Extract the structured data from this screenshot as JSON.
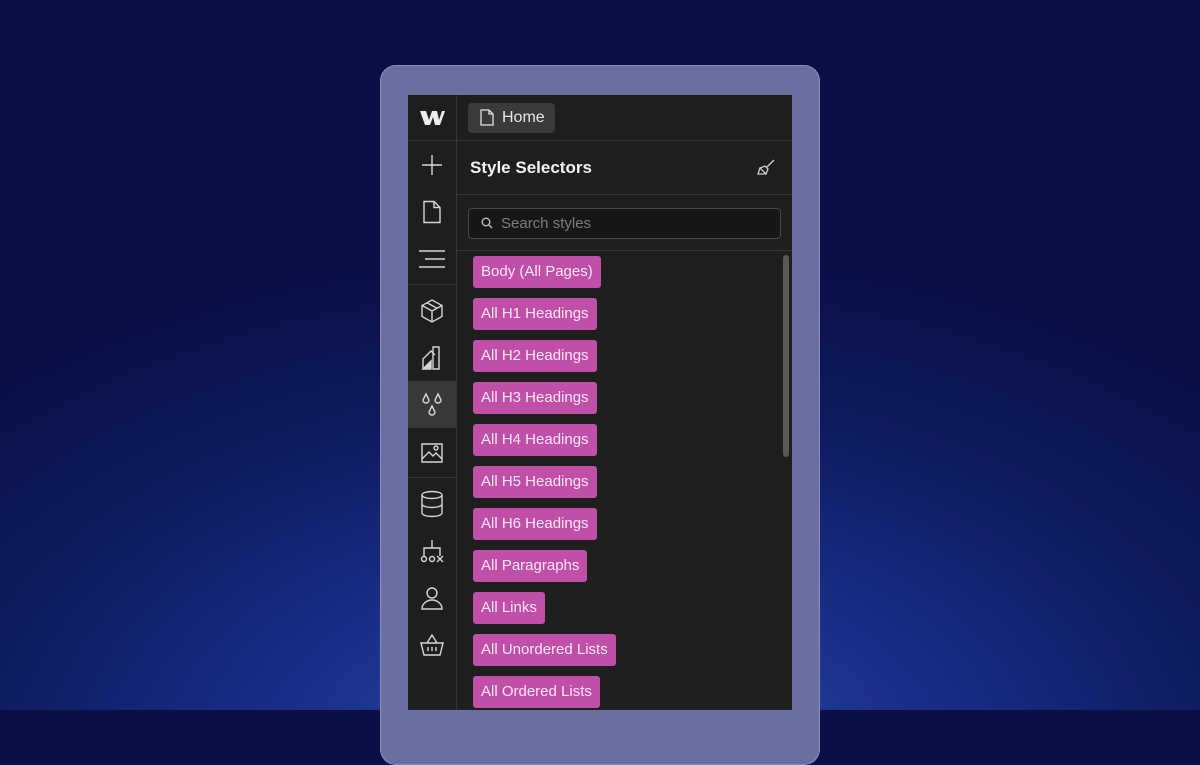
{
  "app": {
    "page_tab_label": "Home",
    "panel_title": "Style Selectors",
    "search_placeholder": "Search styles"
  },
  "rail_icons": [
    "webflow-logo-icon",
    "add-icon",
    "pages-icon",
    "navigator-icon",
    "components-icon",
    "variables-icon",
    "style-selectors-icon",
    "assets-icon",
    "cms-icon",
    "logic-icon",
    "users-icon",
    "ecommerce-icon"
  ],
  "selectors": [
    "Body (All Pages)",
    "All H1 Headings",
    "All H2 Headings",
    "All H3 Headings",
    "All H4 Headings",
    "All H5 Headings",
    "All H6 Headings",
    "All Paragraphs",
    "All Links",
    "All Unordered Lists",
    "All Ordered Lists"
  ],
  "colors": {
    "chip_bg": "#c04fa7",
    "panel_bg": "#1e1e1e",
    "page_bg": "#0e1a5e"
  }
}
